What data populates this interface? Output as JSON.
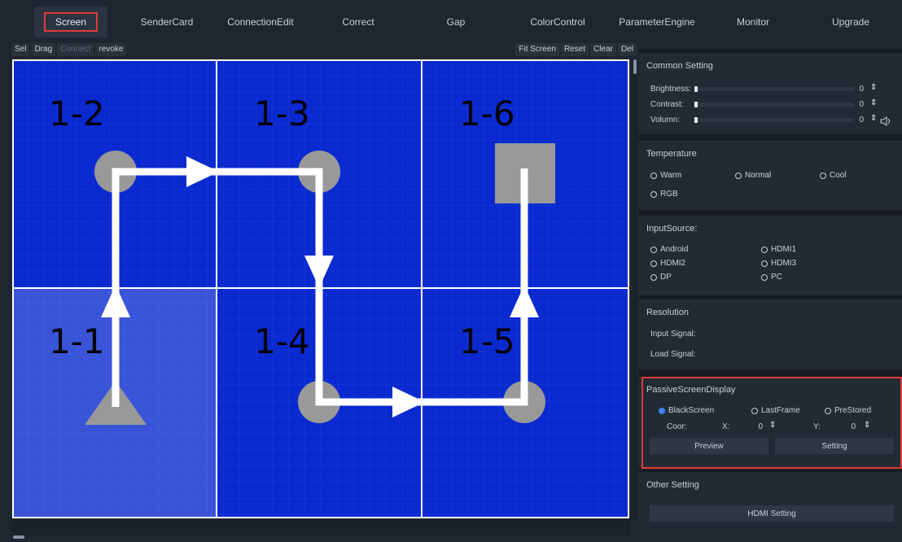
{
  "nav": {
    "tabs": [
      {
        "label": "Screen",
        "active": true
      },
      {
        "label": "SenderCard"
      },
      {
        "label": "ConnectionEdit"
      },
      {
        "label": "Correct"
      },
      {
        "label": "Gap"
      },
      {
        "label": "ColorControl"
      },
      {
        "label": "ParameterEngine"
      },
      {
        "label": "Monitor"
      },
      {
        "label": "Upgrade"
      }
    ]
  },
  "toolbar": {
    "left": [
      "Sel",
      "Drag",
      "Connect",
      "revoke"
    ],
    "right": [
      "Fit Screen",
      "Reset",
      "Clear",
      "Del"
    ]
  },
  "canvas": {
    "panels": [
      "1-2",
      "1-3",
      "1-6",
      "1-1",
      "1-4",
      "1-5"
    ],
    "colors": {
      "panel": "#0a2ad0",
      "panel_selected": "#3954d8",
      "marker": "#999999",
      "route": "#ffffff"
    }
  },
  "common": {
    "title": "Common Setting",
    "brightness_label": "Brightness:",
    "brightness_value": "0",
    "contrast_label": "Contrast:",
    "contrast_value": "0",
    "volume_label": "Volumn:",
    "volume_value": "0"
  },
  "temperature": {
    "title": "Temperature",
    "options": [
      "Warm",
      "Normal",
      "Cool",
      "RGB"
    ]
  },
  "input": {
    "title": "InputSource:",
    "options": [
      "Android",
      "HDMI1",
      "HDMI2",
      "HDMI3",
      "DP",
      "PC"
    ]
  },
  "resolution": {
    "title": "Resolution",
    "input_signal": "Input Signal:",
    "load_signal": "Load Signal:"
  },
  "passive": {
    "title": "PassiveScreenDisplay",
    "options": [
      "BlackScreen",
      "LastFrame",
      "PreStored"
    ],
    "selected": "BlackScreen",
    "coor_label": "Coor:",
    "x_label": "X:",
    "x_value": "0",
    "y_label": "Y:",
    "y_value": "0",
    "preview": "Preview",
    "setting": "Setting"
  },
  "other": {
    "title": "Other Setting",
    "hdmi": "HDMI Setting"
  }
}
